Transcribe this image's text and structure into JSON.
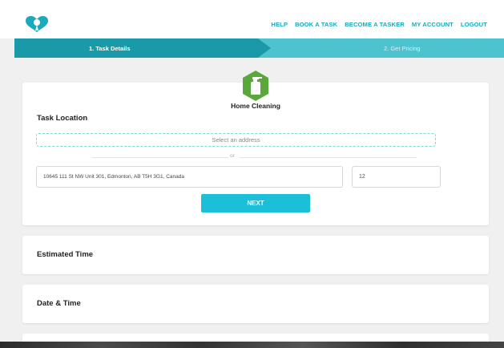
{
  "header": {
    "nav": [
      "HELP",
      "BOOK A TASK",
      "BECOME A TASKER",
      "MY ACCOUNT",
      "LOGOUT"
    ]
  },
  "steps": {
    "step1": "1. Task Details",
    "step2": "2. Get Pricing"
  },
  "task": {
    "service_name": "Home Cleaning",
    "location_title": "Task Location",
    "select_address": "Select an address",
    "or_text": "or",
    "address_value": "10645 111 St NW Unit 301, Edmonton, AB T5H 3G1, Canada",
    "unit_value": "12",
    "next_label": "NEXT"
  },
  "sections": {
    "estimated_time": "Estimated Time",
    "date_time": "Date & Time"
  },
  "colors": {
    "accent": "#1bbfd7",
    "step_active": "#1a9aa8",
    "step_inactive": "#4cc3cf",
    "badge_green": "#5aa83b"
  }
}
